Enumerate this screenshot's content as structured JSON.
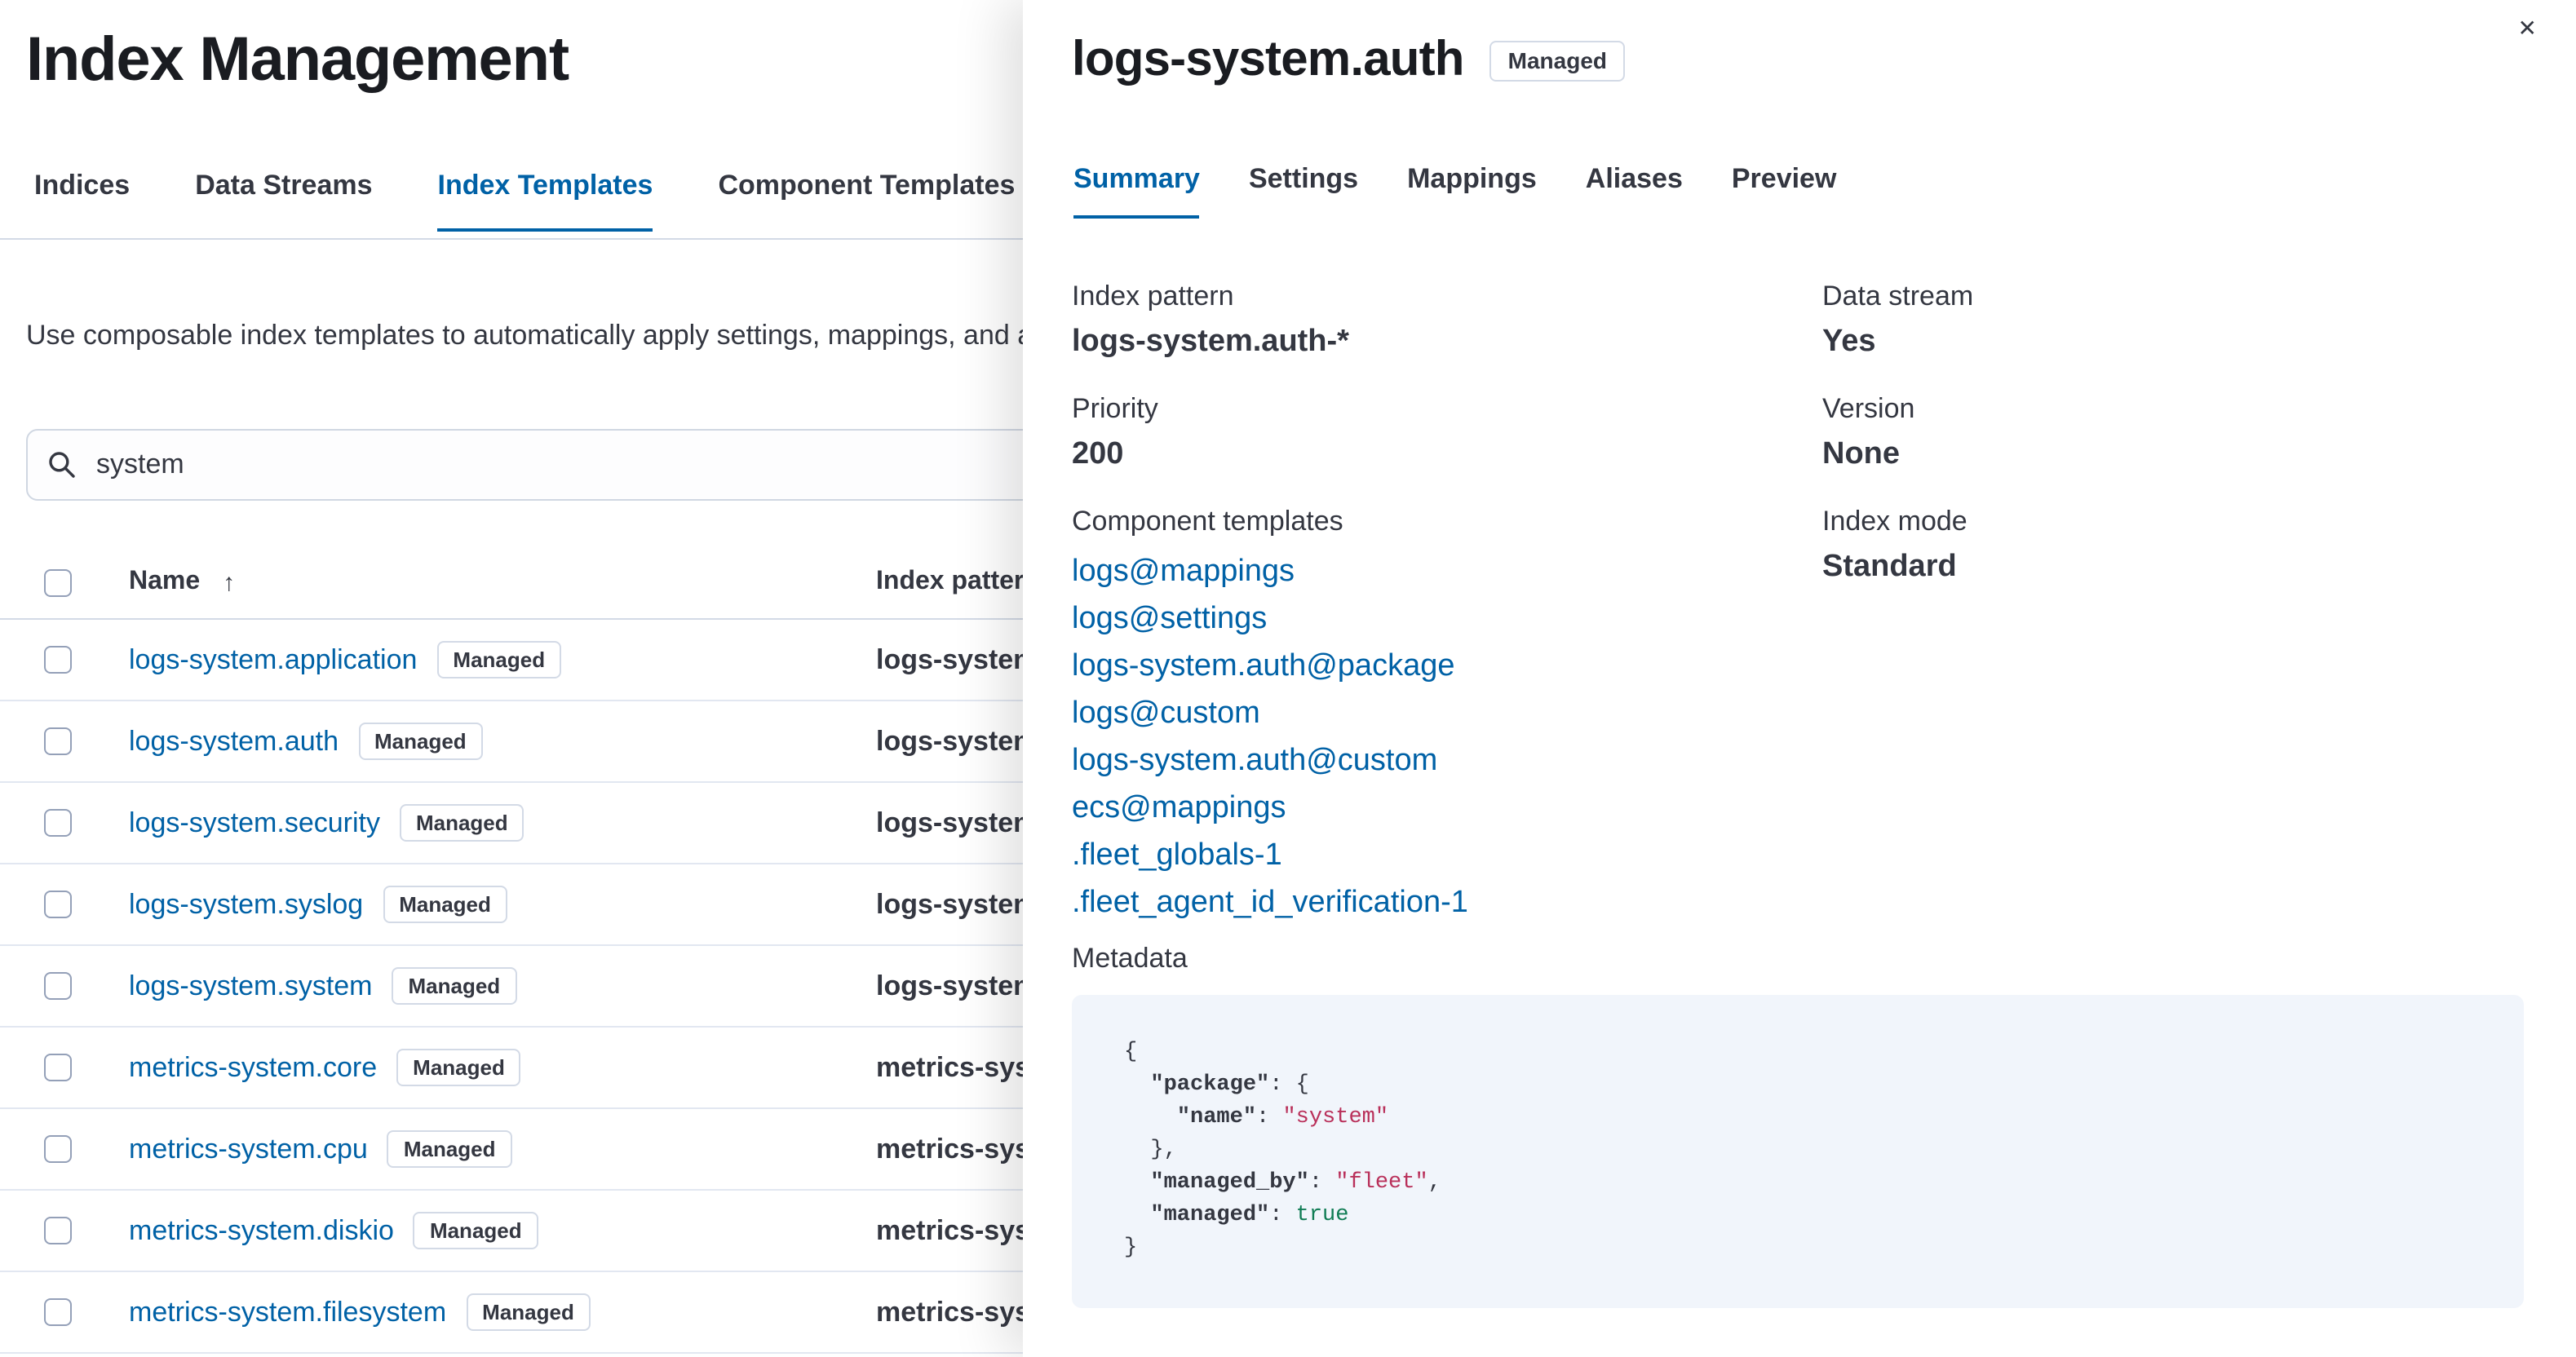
{
  "colors": {
    "link": "#0061a6",
    "text": "#343741",
    "heading": "#1a1c21",
    "divider": "#d3dae6",
    "code_background": "#f1f5fb",
    "code_string": "#b9305a",
    "code_boolean": "#107c54"
  },
  "page": {
    "title": "Index Management",
    "tabs": [
      {
        "label": "Indices",
        "selected": false
      },
      {
        "label": "Data Streams",
        "selected": false
      },
      {
        "label": "Index Templates",
        "selected": true
      },
      {
        "label": "Component Templates",
        "selected": false
      }
    ],
    "description": "Use composable index templates to automatically apply settings, mappings, and aliases to your indices.",
    "search": {
      "value": "system"
    },
    "table": {
      "columns": {
        "name": "Name",
        "index_patterns": "Index patterns"
      },
      "sort_glyph": "↑",
      "rows": [
        {
          "name": "logs-system.application",
          "badge": "Managed",
          "pattern": "logs-system.application-*"
        },
        {
          "name": "logs-system.auth",
          "badge": "Managed",
          "pattern": "logs-system.auth-*"
        },
        {
          "name": "logs-system.security",
          "badge": "Managed",
          "pattern": "logs-system.security-*"
        },
        {
          "name": "logs-system.syslog",
          "badge": "Managed",
          "pattern": "logs-system.syslog-*"
        },
        {
          "name": "logs-system.system",
          "badge": "Managed",
          "pattern": "logs-system.system-*"
        },
        {
          "name": "metrics-system.core",
          "badge": "Managed",
          "pattern": "metrics-system.core-*"
        },
        {
          "name": "metrics-system.cpu",
          "badge": "Managed",
          "pattern": "metrics-system.cpu-*"
        },
        {
          "name": "metrics-system.diskio",
          "badge": "Managed",
          "pattern": "metrics-system.diskio-*"
        },
        {
          "name": "metrics-system.filesystem",
          "badge": "Managed",
          "pattern": "metrics-system.filesystem-*"
        }
      ]
    }
  },
  "flyout": {
    "title": "logs-system.auth",
    "badge": "Managed",
    "close_glyph": "✕",
    "tabs": [
      {
        "label": "Summary",
        "selected": true
      },
      {
        "label": "Settings",
        "selected": false
      },
      {
        "label": "Mappings",
        "selected": false
      },
      {
        "label": "Aliases",
        "selected": false
      },
      {
        "label": "Preview",
        "selected": false
      }
    ],
    "summary": {
      "left": [
        {
          "label": "Index pattern",
          "value": "logs-system.auth-*"
        },
        {
          "label": "Priority",
          "value": "200"
        }
      ],
      "component_templates_label": "Component templates",
      "component_templates": [
        "logs@mappings",
        "logs@settings",
        "logs-system.auth@package",
        "logs@custom",
        "logs-system.auth@custom",
        "ecs@mappings",
        ".fleet_globals-1",
        ".fleet_agent_id_verification-1"
      ],
      "right": [
        {
          "label": "Data stream",
          "value": "Yes"
        },
        {
          "label": "Version",
          "value": "None"
        },
        {
          "label": "Index mode",
          "value": "Standard"
        }
      ],
      "metadata_label": "Metadata"
    },
    "metadata_code": {
      "lines": [
        [
          {
            "t": "{",
            "c": "p"
          }
        ],
        [
          {
            "t": "  ",
            "c": "p"
          },
          {
            "t": "\"package\"",
            "c": "k"
          },
          {
            "t": ": ",
            "c": "p"
          },
          {
            "t": "{",
            "c": "p"
          }
        ],
        [
          {
            "t": "    ",
            "c": "p"
          },
          {
            "t": "\"name\"",
            "c": "k"
          },
          {
            "t": ": ",
            "c": "p"
          },
          {
            "t": "\"system\"",
            "c": "s"
          }
        ],
        [
          {
            "t": "  },",
            "c": "p"
          }
        ],
        [
          {
            "t": "  ",
            "c": "p"
          },
          {
            "t": "\"managed_by\"",
            "c": "k"
          },
          {
            "t": ": ",
            "c": "p"
          },
          {
            "t": "\"fleet\"",
            "c": "s"
          },
          {
            "t": ",",
            "c": "p"
          }
        ],
        [
          {
            "t": "  ",
            "c": "p"
          },
          {
            "t": "\"managed\"",
            "c": "k"
          },
          {
            "t": ": ",
            "c": "p"
          },
          {
            "t": "true",
            "c": "b"
          }
        ],
        [
          {
            "t": "}",
            "c": "p"
          }
        ]
      ]
    }
  }
}
